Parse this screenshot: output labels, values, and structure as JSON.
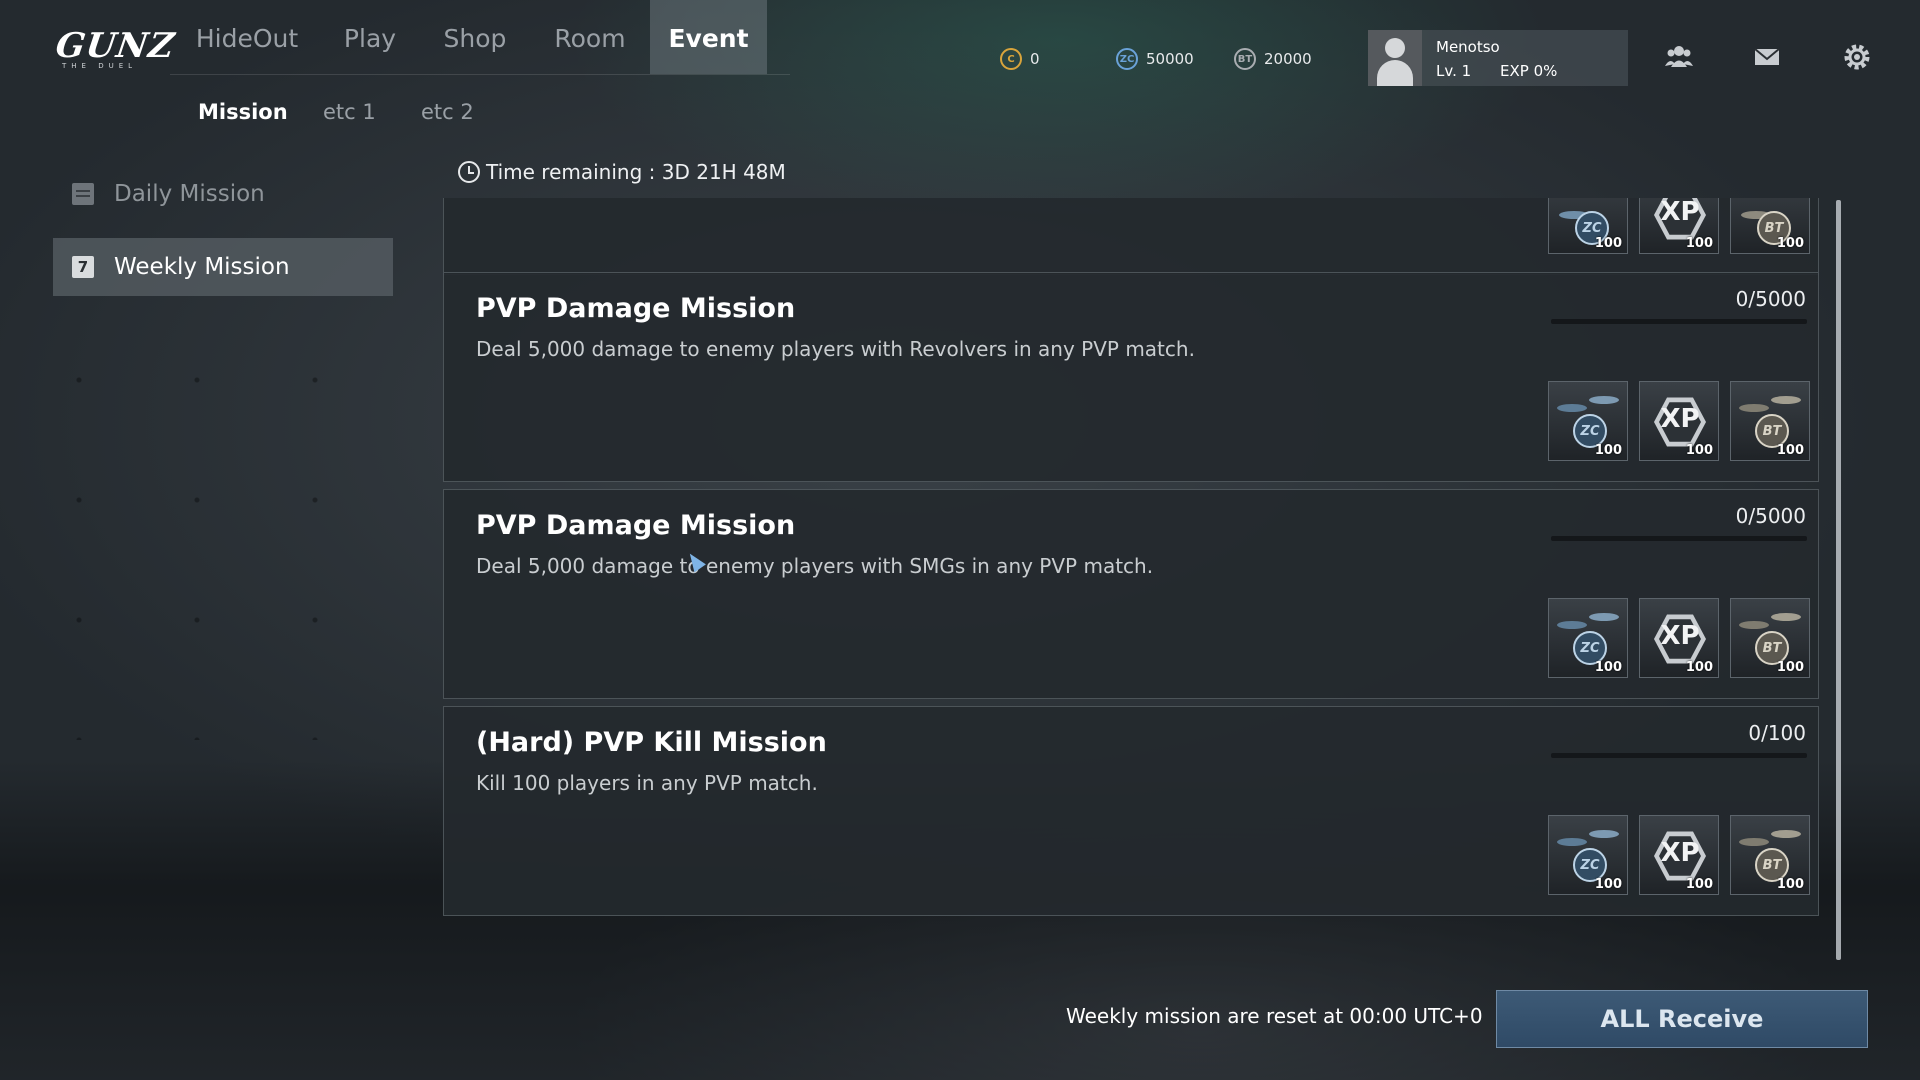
{
  "logo": {
    "main": "GUNZ",
    "sub": "THE DUEL"
  },
  "nav": {
    "tabs": [
      "HideOut",
      "Play",
      "Shop",
      "Room",
      "Event"
    ],
    "active": "Event"
  },
  "currencies": [
    {
      "icon": "coin-c-icon",
      "symbol": "C",
      "value": "0",
      "color": "#d9a43b"
    },
    {
      "icon": "zc-coin-icon",
      "symbol": "ZC",
      "value": "50000",
      "color": "#6aa2d8"
    },
    {
      "icon": "bt-coin-icon",
      "symbol": "BT",
      "value": "20000",
      "color": "#a9adb1"
    }
  ],
  "profile": {
    "name": "Menotso",
    "level": "Lv. 1",
    "exp": "EXP  0%"
  },
  "top_icons": [
    "friends-icon",
    "mail-icon",
    "settings-icon"
  ],
  "subtabs": {
    "items": [
      "Mission",
      "etc 1",
      "etc 2"
    ],
    "active": "Mission"
  },
  "sidebar": {
    "items": [
      {
        "label": "Daily Mission",
        "icon": "daily-calendar-icon",
        "active": false
      },
      {
        "label": "Weekly Mission",
        "icon": "weekly-calendar-icon",
        "icon_text": "7",
        "active": true
      }
    ]
  },
  "time_remaining": "Time remaining : 3D 21H 48M",
  "missions": [
    {
      "title": "PVP Damage Mission",
      "description": "Deal 5,000 damage to enemy players with Revolvers in any PVP match.",
      "progress": "0/5000",
      "progress_fraction": 0,
      "rewards": [
        {
          "type": "ZC",
          "qty": "100"
        },
        {
          "type": "XP",
          "qty": "100"
        },
        {
          "type": "BT",
          "qty": "100"
        }
      ]
    },
    {
      "title": "PVP Damage Mission",
      "description": "Deal 5,000 damage to enemy players with SMGs in any PVP match.",
      "progress": "0/5000",
      "progress_fraction": 0,
      "rewards": [
        {
          "type": "ZC",
          "qty": "100"
        },
        {
          "type": "XP",
          "qty": "100"
        },
        {
          "type": "BT",
          "qty": "100"
        }
      ]
    },
    {
      "title": "(Hard) PVP Kill Mission",
      "description": "Kill 100 players in any PVP match.",
      "progress": "0/100",
      "progress_fraction": 0,
      "rewards": [
        {
          "type": "ZC",
          "qty": "100"
        },
        {
          "type": "XP",
          "qty": "100"
        },
        {
          "type": "BT",
          "qty": "100"
        }
      ]
    }
  ],
  "partial_card_rewards": [
    {
      "type": "ZC",
      "qty": "100"
    },
    {
      "type": "XP",
      "qty": "100"
    },
    {
      "type": "BT",
      "qty": "100"
    }
  ],
  "footer": {
    "reset_note": "Weekly mission are reset at 00:00 UTC+0",
    "all_receive": "ALL Receive"
  }
}
